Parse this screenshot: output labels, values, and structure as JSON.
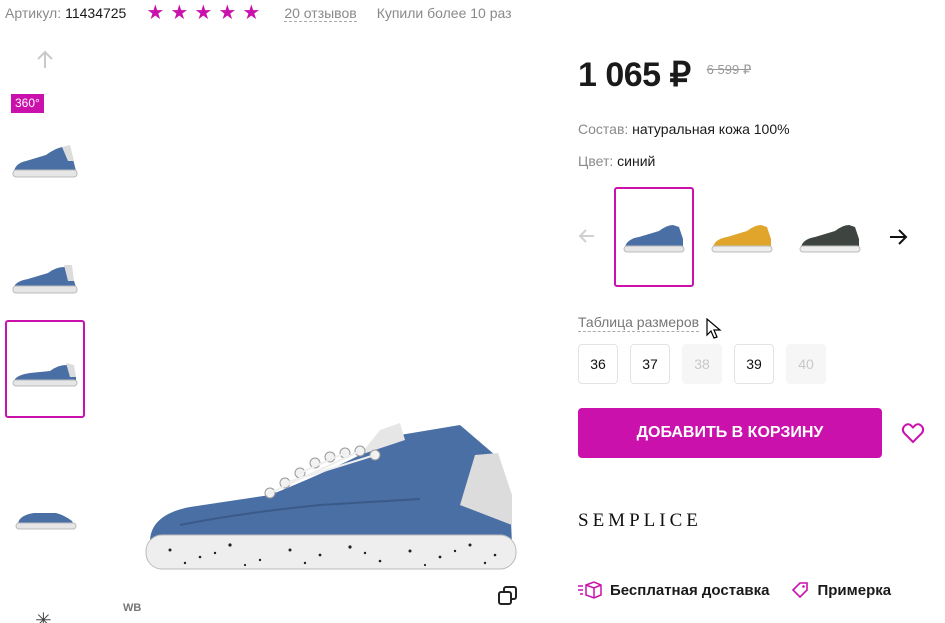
{
  "top": {
    "article_label": "Артикул:",
    "article_value": "11434725",
    "rating_stars": 5,
    "reviews": "20 отзывов",
    "bought": "Купили более 10 раз"
  },
  "gallery": {
    "badge": "360°",
    "thumbnails": [
      {
        "name": "thumb-1",
        "active": false
      },
      {
        "name": "thumb-2",
        "active": false
      },
      {
        "name": "thumb-3",
        "active": true
      },
      {
        "name": "thumb-4",
        "active": false
      }
    ],
    "watermark": "WB"
  },
  "product": {
    "price": "1 065 ₽",
    "old_price": "6 599 ₽",
    "composition_label": "Состав:",
    "composition_value": "натуральная кожа 100%",
    "color_label": "Цвет:",
    "color_value": "синий",
    "color_options": [
      {
        "name": "blue",
        "hex": "#4a6fa5",
        "active": true
      },
      {
        "name": "yellow",
        "hex": "#e0a52a",
        "active": false
      },
      {
        "name": "dark-green",
        "hex": "#3e4540",
        "active": false
      }
    ],
    "size_table_link": "Таблица размеров",
    "sizes": [
      {
        "label": "36",
        "available": true
      },
      {
        "label": "37",
        "available": true
      },
      {
        "label": "38",
        "available": false
      },
      {
        "label": "39",
        "available": true
      },
      {
        "label": "40",
        "available": false
      }
    ],
    "add_to_cart": "Добавить в корзину",
    "brand": "SEMPLICE",
    "perk_delivery": "Бесплатная доставка",
    "perk_fitting": "Примерка"
  },
  "colors": {
    "accent": "#cb11ab"
  }
}
